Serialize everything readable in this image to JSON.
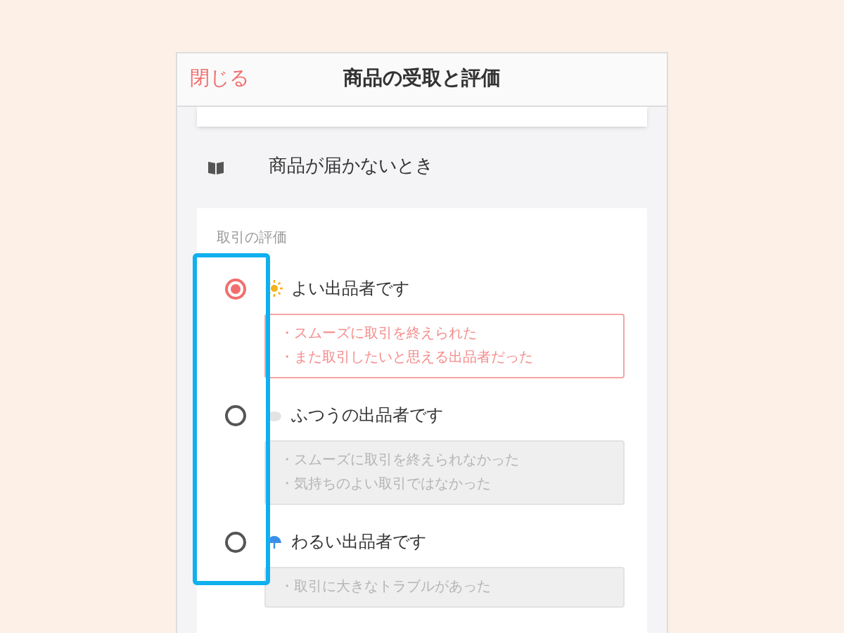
{
  "header": {
    "close": "閉じる",
    "title": "商品の受取と評価"
  },
  "help_link": {
    "label": "商品が届かないとき"
  },
  "rating": {
    "heading": "取引の評価",
    "options": [
      {
        "label": "よい出品者です",
        "kind": "sun",
        "selected": true,
        "notes": [
          "・スムーズに取引を終えられた",
          "・また取引したいと思える出品者だった"
        ]
      },
      {
        "label": "ふつうの出品者です",
        "kind": "cloud",
        "selected": false,
        "notes": [
          "・スムーズに取引を終えられなかった",
          "・気持ちのよい取引ではなかった"
        ]
      },
      {
        "label": "わるい出品者です",
        "kind": "umbrella",
        "selected": false,
        "notes": [
          "・取引に大きなトラブルがあった"
        ]
      }
    ]
  }
}
